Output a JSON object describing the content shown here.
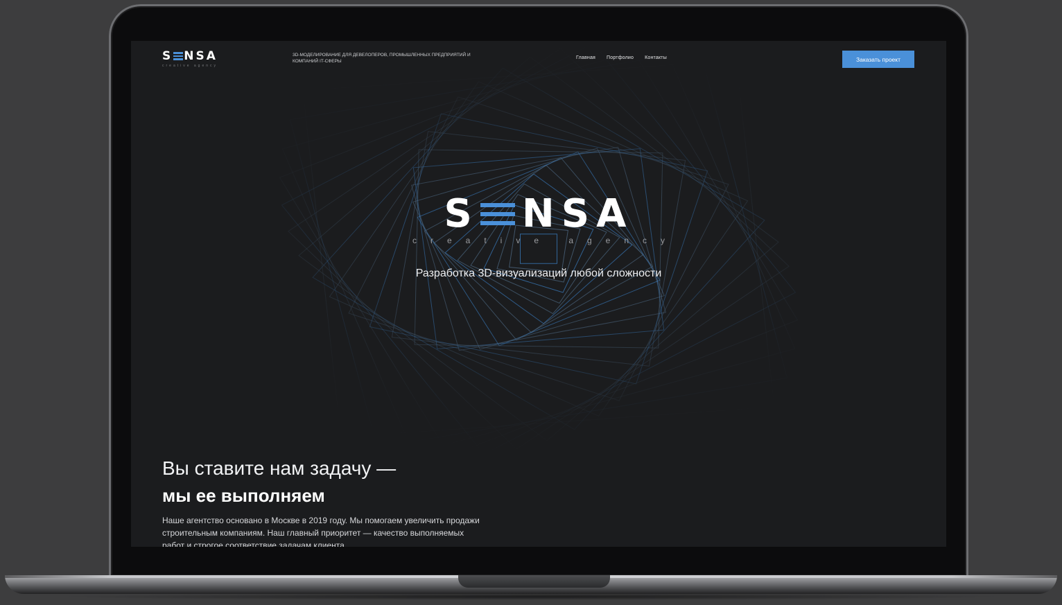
{
  "header": {
    "logo_text_left": "S",
    "logo_text_right": "NSA",
    "logo_tagline": "creative agency",
    "tagline": "3D-моделирование для девелоперов, промышленных предприятий и компаний IT-сферы",
    "nav": [
      "Главная",
      "Портфолио",
      "Контакты"
    ],
    "cta_label": "Заказать проект"
  },
  "hero": {
    "logo_text_left": "S",
    "logo_text_right": "NSA",
    "logo_tagline": "creative agency",
    "subtitle": "Разработка 3D-визуализаций любой сложности"
  },
  "about": {
    "title": "Вы ставите нам задачу —",
    "title_bold": "мы ее выполняем",
    "text": "Наше агентство основано в Москве в 2019 году. Мы помогаем увеличить продажи строительным компаниям. Наш главный приоритет — качество выполняемых работ и строгое соответствие задачам клиента."
  },
  "colors": {
    "accent": "#4a90d9",
    "background": "#1b1c1e",
    "frame": "#3d3d3e"
  }
}
